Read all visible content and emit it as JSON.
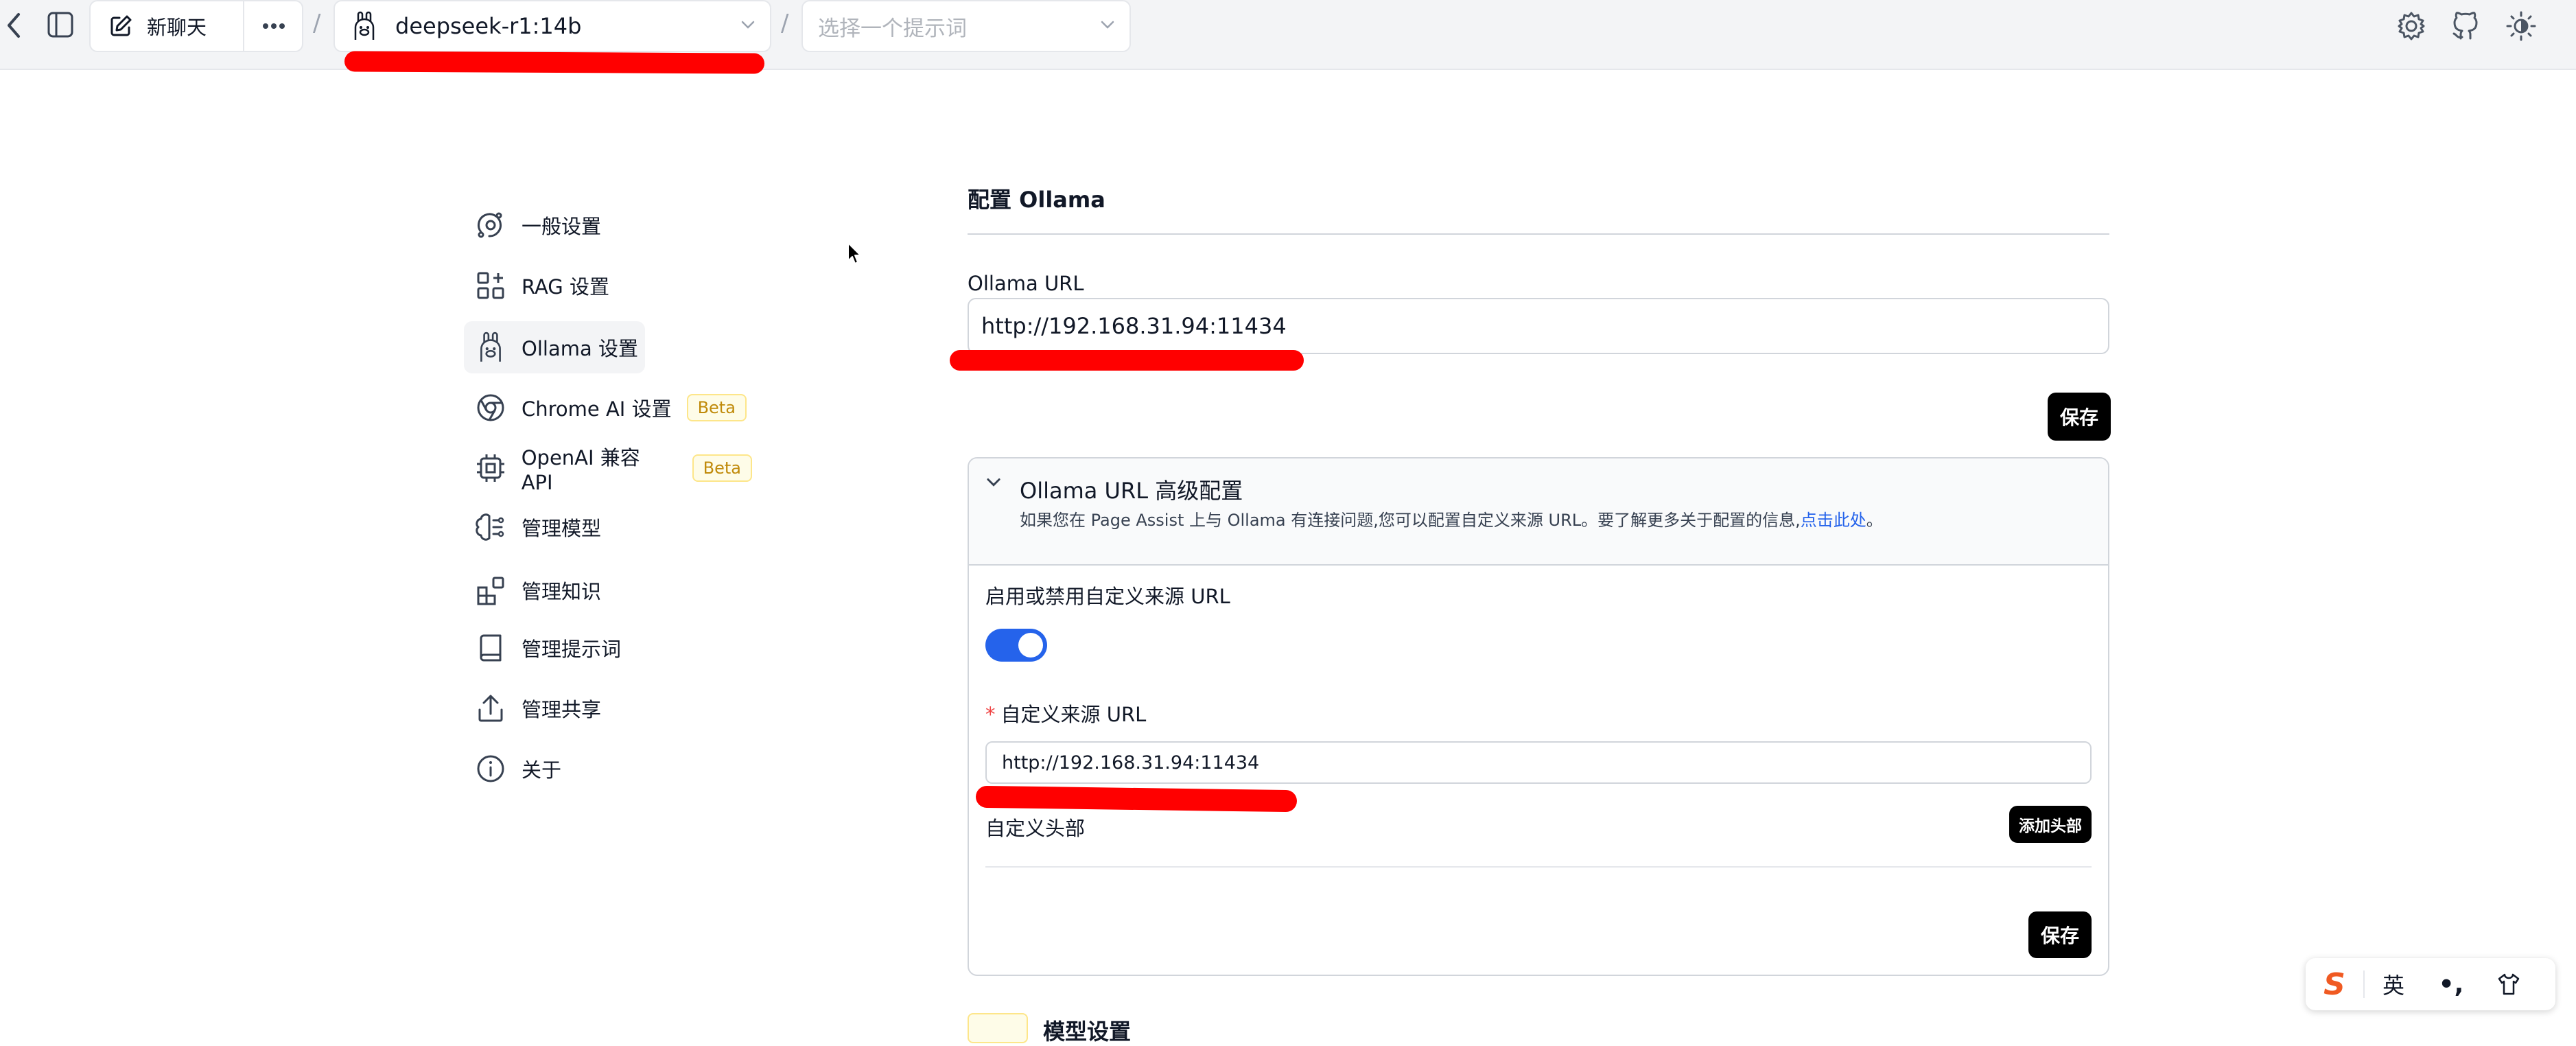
{
  "topbar": {
    "new_chat_label": "新聊天",
    "model_name": "deepseek-r1:14b",
    "prompt_placeholder": "选择一个提示词",
    "separator": "/"
  },
  "sidebar": {
    "items": [
      {
        "label": "一般设置"
      },
      {
        "label": "RAG 设置"
      },
      {
        "label": "Ollama 设置"
      },
      {
        "label": "Chrome AI 设置",
        "badge": "Beta"
      },
      {
        "label": "OpenAI 兼容 API",
        "badge": "Beta"
      },
      {
        "label": "管理模型"
      },
      {
        "label": "管理知识"
      },
      {
        "label": "管理提示词"
      },
      {
        "label": "管理共享"
      },
      {
        "label": "关于"
      }
    ]
  },
  "main": {
    "title": "配置 Ollama",
    "url_label": "Ollama URL",
    "url_value": "http://192.168.31.94:11434",
    "save_label": "保存",
    "advanced": {
      "title": "Ollama URL 高级配置",
      "description": "如果您在 Page Assist 上与 Ollama 有连接问题,您可以配置自定义来源 URL。要了解更多关于配置的信息,",
      "link_text": "点击此处",
      "desc_end": "。",
      "toggle_label": "启用或禁用自定义来源 URL",
      "toggle_on": true,
      "required_star": "*",
      "origin_label": "自定义来源 URL",
      "origin_value": "http://192.168.31.94:11434",
      "headers_label": "自定义头部",
      "add_header_label": "添加头部",
      "save_label": "保存"
    },
    "next_section_title": "模型设置"
  },
  "ime": {
    "logo": "S",
    "lang": "英",
    "punct": "•,"
  },
  "colors": {
    "accent": "#2563eb",
    "annotation": "#ff0000",
    "beta_text": "#c08a0a"
  }
}
